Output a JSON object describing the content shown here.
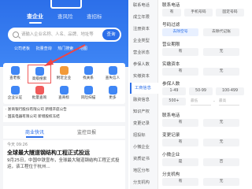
{
  "left": {
    "tabs": [
      "查企业",
      "查风险",
      "查招标"
    ],
    "search": {
      "placeholder": "请输入企业名称、人名、品牌、地址等",
      "button": "查询"
    },
    "chips": [
      "公司老板",
      "批量查询",
      "热门搜索",
      "地图"
    ],
    "grid": [
      {
        "label": "查老板",
        "icon": "boss-icon",
        "color": "#3f86f5"
      },
      {
        "label": "高级搜索",
        "icon": "advanced-search-icon",
        "color": "#3f86f5"
      },
      {
        "label": "附近企业",
        "icon": "nearby-icon",
        "color": "#f29a38"
      },
      {
        "label": "找关系",
        "icon": "relation-icon",
        "color": "#3f86f5"
      },
      {
        "label": "查失信人",
        "icon": "dishonest-icon",
        "color": "#3f86f5"
      },
      {
        "label": "企业认证",
        "icon": "cert-icon",
        "color": "#3f86f5"
      },
      {
        "label": "批量查询",
        "icon": "batch-icon",
        "color": "#f05a5a"
      },
      {
        "label": "查商标",
        "icon": "trademark-icon",
        "color": "#3f86f5"
      },
      {
        "label": "风险扫描",
        "icon": "risk-icon",
        "color": "#3f86f5"
      },
      {
        "label": "更多",
        "icon": "more-icon",
        "color": "#3f86f5"
      }
    ],
    "news": [
      "· 浙商银行股份有限公司 新增开庭公告",
      "· 国美电器有限公司 新增股权冻结"
    ],
    "content_tabs": [
      "商业快讯",
      "监控日报"
    ],
    "article": {
      "date": "今天 09:26",
      "title": "全球最大隧道钢结构工程正式投运",
      "body": "9月25日，中国中铁宣布，全球最大隧道钢结构工程正式投运，该工程位于杭州..."
    }
  },
  "right": {
    "sidebar": [
      "联系电话",
      "成立年限",
      "注册资本",
      "企业类型",
      "营业状态",
      "参保人数",
      "实缴资本",
      "工商信息",
      "融资信息",
      "知识产权",
      "变更记录",
      "招投标",
      "小微企业",
      "资质证书",
      "地区分布",
      "分支机构"
    ],
    "sections": [
      {
        "title": "联系电话",
        "options": [
          "有",
          "手机号码",
          "固定号码"
        ]
      },
      {
        "title": "号码过滤",
        "options": [
          "去除空号",
          "去除代记账"
        ]
      },
      {
        "title": "营业期限",
        "options": [
          "有",
          "无"
        ]
      },
      {
        "title": "实缴资本",
        "options": [
          "有",
          "无"
        ]
      },
      {
        "title": "参保人数",
        "options": [
          "1-49",
          "50-99",
          "100-499",
          "500+"
        ]
      },
      {
        "title": "联系电话",
        "options": [
          "有",
          "无"
        ]
      },
      {
        "title": "变更记录",
        "options": [
          "有",
          "无"
        ]
      },
      {
        "title": "小微企业",
        "options": [
          "是",
          "否"
        ]
      },
      {
        "title": "分支机构",
        "options": [
          "有",
          "无"
        ]
      }
    ],
    "range_placeholder": "最低",
    "range_placeholder_max": "最高"
  }
}
